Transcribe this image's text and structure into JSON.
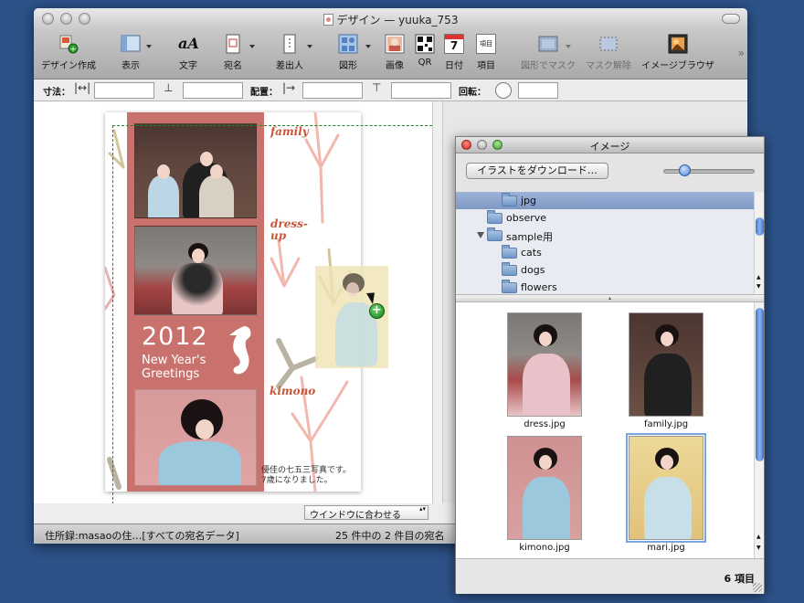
{
  "window": {
    "title": "デザイン — yuuka_753"
  },
  "toolbar": {
    "design": "デザイン作成",
    "view": "表示",
    "text": "文字",
    "address": "宛名",
    "sender": "差出人",
    "shape": "図形",
    "image": "画像",
    "qr": "QR",
    "date": "日付",
    "item": "項目",
    "mask_shape": "図形でマスク",
    "mask_release": "マスク解除",
    "image_browser": "イメージブラウザ",
    "date_icon_number": "7",
    "item_icon_text": "項目",
    "text_icon": "aA"
  },
  "propbar": {
    "size_label": "寸法：",
    "position_label": "配置：",
    "rotation_label": "回転："
  },
  "card": {
    "year": "2012",
    "new_years": "New Year's",
    "greetings": "Greetings",
    "caption_family": "family",
    "caption_dress_1": "dress-",
    "caption_dress_2": "up",
    "caption_kimono": "kimono",
    "message_1": "優佳の七五三写真です。",
    "message_2": "7歳になりました。"
  },
  "fit_dropdown": "ウインドウに合わせる",
  "status": {
    "left": "住所録:masaoの住…[すべての宛名データ]",
    "right": "25 件中の 2 件目の宛名"
  },
  "panel": {
    "title": "イメージ",
    "download_button": "イラストをダウンロード…",
    "folders": [
      {
        "name": "jpg",
        "level": 2,
        "selected": true
      },
      {
        "name": "observe",
        "level": 1
      },
      {
        "name": "sample用",
        "level": 1,
        "expanded": true
      },
      {
        "name": "cats",
        "level": 2
      },
      {
        "name": "dogs",
        "level": 2
      },
      {
        "name": "flowers",
        "level": 2
      }
    ],
    "images": [
      {
        "name": "dress.jpg"
      },
      {
        "name": "family.jpg"
      },
      {
        "name": "kimono.jpg"
      },
      {
        "name": "mari.jpg",
        "selected": true
      }
    ],
    "count": "6 項目",
    "zoom_level": 0.2
  },
  "colors": {
    "desktop": "#2c5288",
    "card_red": "#c9726d",
    "caption": "#c8553a",
    "selection": "#7f98c4"
  }
}
